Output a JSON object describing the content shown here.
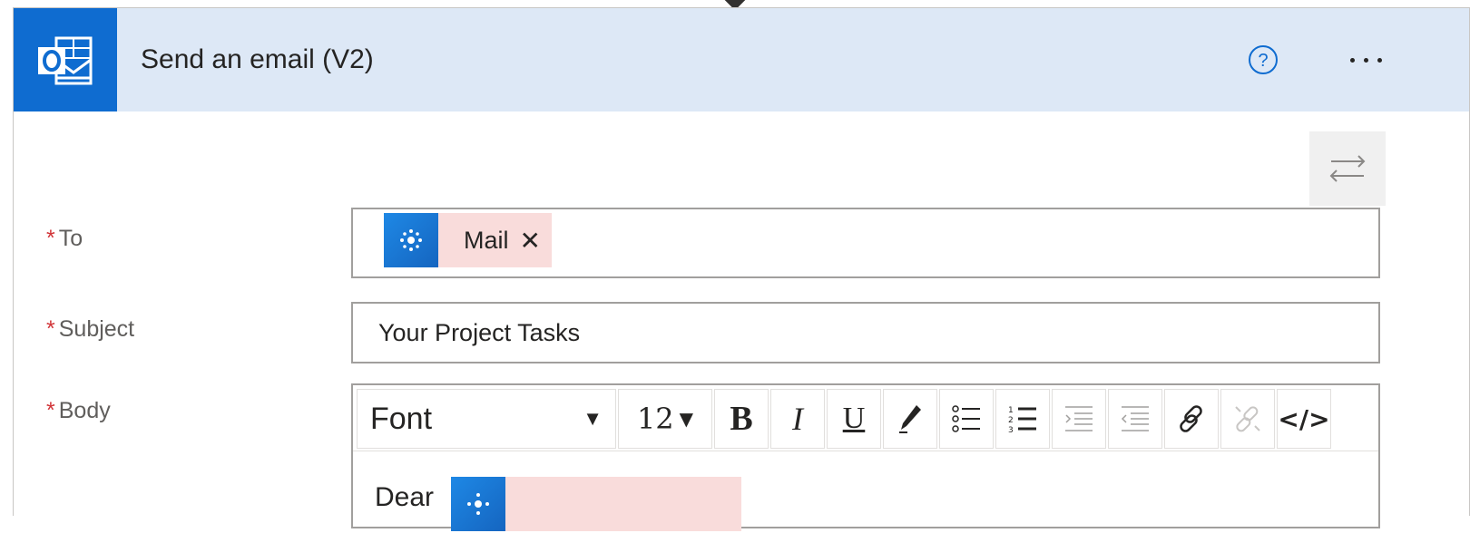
{
  "header": {
    "title": "Send an email (V2)",
    "icons": {
      "app": "outlook-icon",
      "help": "help-icon",
      "more": "more-options-icon"
    }
  },
  "fields": {
    "to": {
      "label": "To",
      "required_mark": "*",
      "token_label": "Mail",
      "token_close": "✕"
    },
    "subject": {
      "label": "Subject",
      "required_mark": "*",
      "value": "Your Project Tasks"
    },
    "body": {
      "label": "Body",
      "required_mark": "*",
      "toolbar": {
        "font": "Font",
        "size": "12",
        "bold": "B",
        "italic": "I",
        "underline": "U",
        "html": "</>"
      },
      "content_prefix": "Dear"
    }
  },
  "colors": {
    "header_bg": "#dde8f6",
    "app_icon_bg": "#0f6cd0",
    "token_bg": "#f9dcdb",
    "required": "#d13438"
  }
}
